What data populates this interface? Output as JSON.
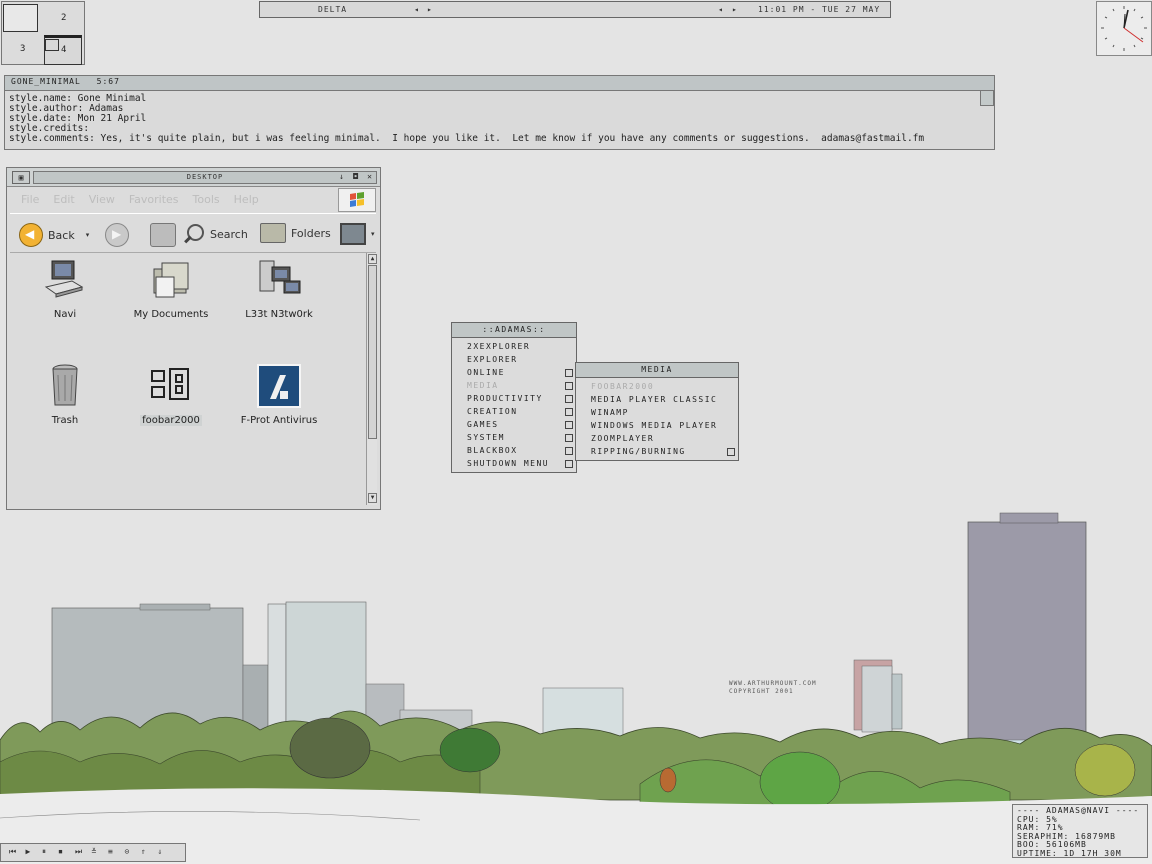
{
  "pager": {
    "workspaces": [
      "2",
      "3",
      "4"
    ]
  },
  "toolbar": {
    "workspace": "DELTA",
    "clock": "11:01 PM - TUE 27 MAY",
    "prev_arrow": "◂",
    "next_arrow": "▸"
  },
  "style_window": {
    "title": "GONE_MINIMAL",
    "page": "5:67",
    "lines": [
      "style.name: Gone Minimal",
      "style.author: Adamas",
      "style.date: Mon 21 April",
      "style.credits:",
      "style.comments: Yes, it's quite plain, but i was feeling minimal.  I hope you like it.  Let me know if you have any comments or suggestions.  adamas@fastmail.fm"
    ]
  },
  "explorer": {
    "title": "DESKTOP",
    "menu": [
      "File",
      "Edit",
      "View",
      "Favorites",
      "Tools",
      "Help"
    ],
    "toolbar": {
      "back": "Back",
      "search": "Search",
      "folders": "Folders"
    },
    "icons": [
      {
        "label": "Navi",
        "icon": "computer-icon"
      },
      {
        "label": "My Documents",
        "icon": "folder-icon"
      },
      {
        "label": "L33t N3tw0rk",
        "icon": "network-icon"
      },
      {
        "label": "Trash",
        "icon": "trash-icon"
      },
      {
        "label": "foobar2000",
        "icon": "foobar-icon"
      },
      {
        "label": "F-Prot Antivirus",
        "icon": "fprot-icon"
      }
    ]
  },
  "root_menu": {
    "title": "::ADAMAS::",
    "items": [
      {
        "label": "2XEXPLORER",
        "submenu": false,
        "disabled": false
      },
      {
        "label": "EXPLORER",
        "submenu": false,
        "disabled": false
      },
      {
        "label": "ONLINE",
        "submenu": true,
        "disabled": false
      },
      {
        "label": "MEDIA",
        "submenu": true,
        "disabled": true
      },
      {
        "label": "PRODUCTIVITY",
        "submenu": true,
        "disabled": false
      },
      {
        "label": "CREATION",
        "submenu": true,
        "disabled": false
      },
      {
        "label": "GAMES",
        "submenu": true,
        "disabled": false
      },
      {
        "label": "SYSTEM",
        "submenu": true,
        "disabled": false
      },
      {
        "label": "BLACKBOX",
        "submenu": true,
        "disabled": false
      },
      {
        "label": "SHUTDOWN MENU",
        "submenu": true,
        "disabled": false
      }
    ]
  },
  "media_menu": {
    "title": "MEDIA",
    "items": [
      {
        "label": "FOOBAR2000",
        "submenu": false,
        "disabled": true
      },
      {
        "label": "MEDIA PLAYER CLASSIC",
        "submenu": false,
        "disabled": false
      },
      {
        "label": "WINAMP",
        "submenu": false,
        "disabled": false
      },
      {
        "label": "WINDOWS MEDIA PLAYER",
        "submenu": false,
        "disabled": false
      },
      {
        "label": "ZOOMPLAYER",
        "submenu": false,
        "disabled": false
      },
      {
        "label": "RIPPING/BURNING",
        "submenu": true,
        "disabled": false
      }
    ]
  },
  "wallpaper": {
    "credit_line1": "WWW.ARTHURMOUNT.COM",
    "credit_line2": "COPYRIGHT 2001"
  },
  "monitor": {
    "header": "---- ADAMAS@NAVI ----",
    "cpu": "CPU: 5%",
    "ram": "RAM: 71%",
    "seraphim": "SERAPHIM: 16879MB",
    "boo": "BOO: 56106MB",
    "uptime": "UPTIME: 1D 17H 30M"
  },
  "media_controls": [
    "⏮",
    "▶",
    "⏸",
    "⏹",
    "⏭",
    "≚",
    "≡",
    "⊙",
    "⇑",
    "⇓"
  ]
}
